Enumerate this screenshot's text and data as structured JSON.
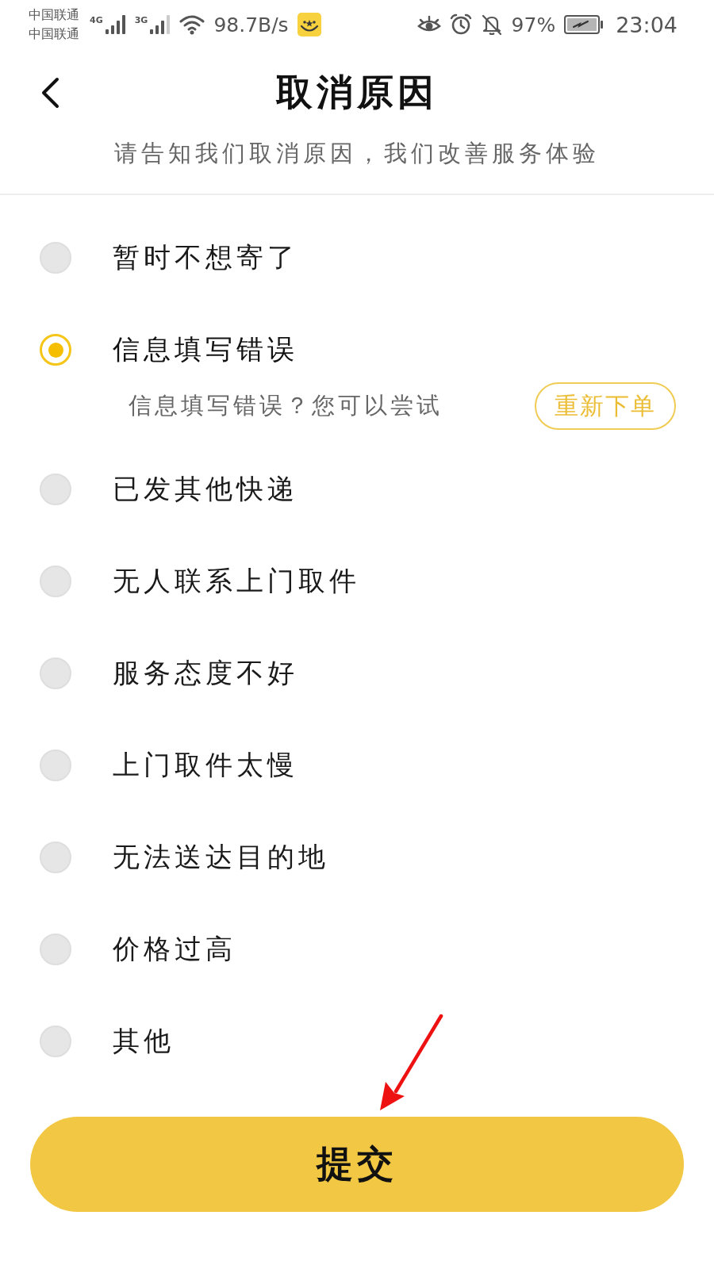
{
  "status_bar": {
    "carriers": [
      "中国联通",
      "中国联通"
    ],
    "networks": [
      {
        "type": "4G"
      },
      {
        "type": "3G"
      }
    ],
    "speed": "98.7B/s",
    "battery": "97%",
    "time": "23:04"
  },
  "header": {
    "title": "取消原因",
    "subtitle": "请告知我们取消原因，我们改善服务体验"
  },
  "reasons": [
    {
      "label": "暂时不想寄了",
      "selected": false
    },
    {
      "label": "信息填写错误",
      "selected": true,
      "hint": {
        "text": "信息填写错误？您可以尝试",
        "action": "重新下单"
      }
    },
    {
      "label": "已发其他快递",
      "selected": false
    },
    {
      "label": "无人联系上门取件",
      "selected": false
    },
    {
      "label": "服务态度不好",
      "selected": false
    },
    {
      "label": "上门取件太慢",
      "selected": false
    },
    {
      "label": "无法送达目的地",
      "selected": false
    },
    {
      "label": "价格过高",
      "selected": false
    },
    {
      "label": "其他",
      "selected": false
    }
  ],
  "submit_button": {
    "label": "提交"
  }
}
